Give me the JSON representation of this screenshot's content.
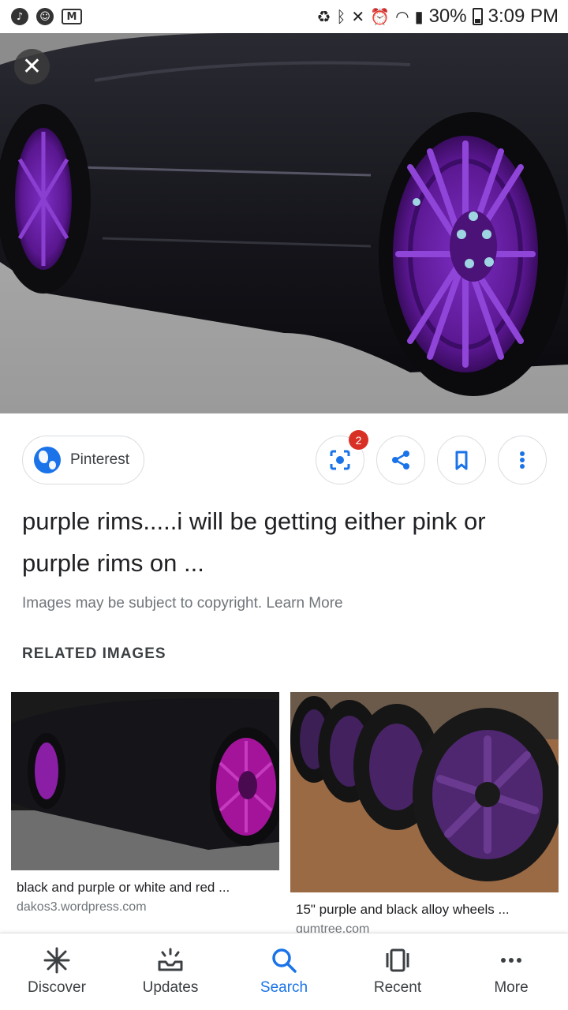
{
  "status_bar": {
    "battery": "30%",
    "time": "3:09 PM"
  },
  "result": {
    "source": "Pinterest",
    "badge_count": "2",
    "title": "purple rims.....i will be getting either pink or purple rims on ...",
    "copyright": "Images may be subject to copyright.",
    "learn_more": "Learn More"
  },
  "related": {
    "heading": "RELATED IMAGES",
    "items": [
      {
        "caption": "black and purple or white and red ...",
        "domain": "dakos3.wordpress.com"
      },
      {
        "caption": "15\" purple and black alloy wheels ...",
        "domain": "gumtree.com"
      }
    ]
  },
  "nav": {
    "items": [
      {
        "label": "Discover",
        "icon": "asterisk-icon"
      },
      {
        "label": "Updates",
        "icon": "inbox-updates-icon"
      },
      {
        "label": "Search",
        "icon": "search-icon"
      },
      {
        "label": "Recent",
        "icon": "recent-tabs-icon"
      },
      {
        "label": "More",
        "icon": "more-dots-icon"
      }
    ],
    "active": "Search"
  },
  "colors": {
    "accent": "#1a73e8",
    "badge": "#d93025",
    "rim": "#6a1fa8"
  }
}
